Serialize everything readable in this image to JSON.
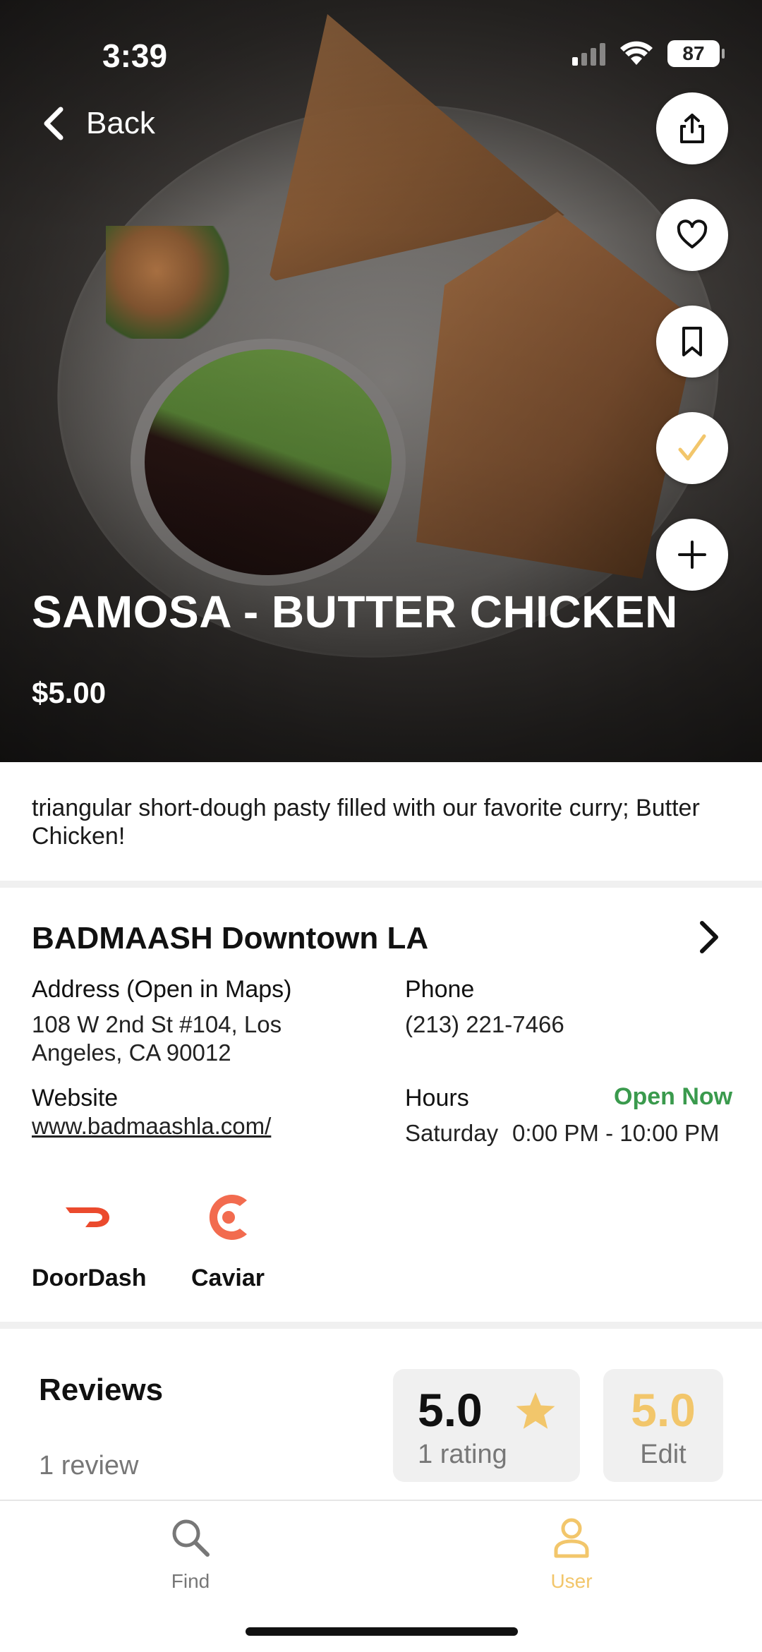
{
  "status_bar": {
    "time": "3:39",
    "battery": "87"
  },
  "nav": {
    "back_label": "Back"
  },
  "actions": [
    {
      "name": "share",
      "icon": "share-icon"
    },
    {
      "name": "favorite",
      "icon": "heart-icon"
    },
    {
      "name": "bookmark",
      "icon": "bookmark-icon"
    },
    {
      "name": "tried",
      "icon": "check-icon"
    },
    {
      "name": "add",
      "icon": "plus-icon"
    }
  ],
  "item": {
    "title": "SAMOSA - BUTTER CHICKEN",
    "price": "$5.00",
    "description": "triangular short-dough pasty filled with our favorite curry; Butter Chicken!"
  },
  "restaurant": {
    "name": "BADMAASH Downtown LA",
    "address_label": "Address (Open in Maps)",
    "address_line1": "108 W 2nd St #104, Los",
    "address_line2": "Angeles, CA 90012",
    "phone_label": "Phone",
    "phone": "(213) 221-7466",
    "website_label": "Website",
    "website": "www.badmaashla.com/",
    "hours_label": "Hours",
    "open_status": "Open Now",
    "hours_day": "Saturday",
    "hours_time": "0:00 PM - 10:00 PM"
  },
  "delivery": [
    {
      "name": "DoorDash",
      "icon": "doordash-icon"
    },
    {
      "name": "Caviar",
      "icon": "caviar-icon"
    }
  ],
  "reviews": {
    "title": "Reviews",
    "count": "1 review",
    "average": "5.0",
    "ratings": "1 rating",
    "my_rating": "5.0",
    "edit_label": "Edit"
  },
  "tabs": [
    {
      "label": "Find",
      "icon": "search-icon",
      "active": false
    },
    {
      "label": "User",
      "icon": "user-icon",
      "active": true
    }
  ],
  "colors": {
    "accent": "#f2c66b",
    "open": "#3a9a4d",
    "doordash": "#eb4a2d",
    "caviar": "#f26b4f",
    "inactive": "#777777"
  }
}
